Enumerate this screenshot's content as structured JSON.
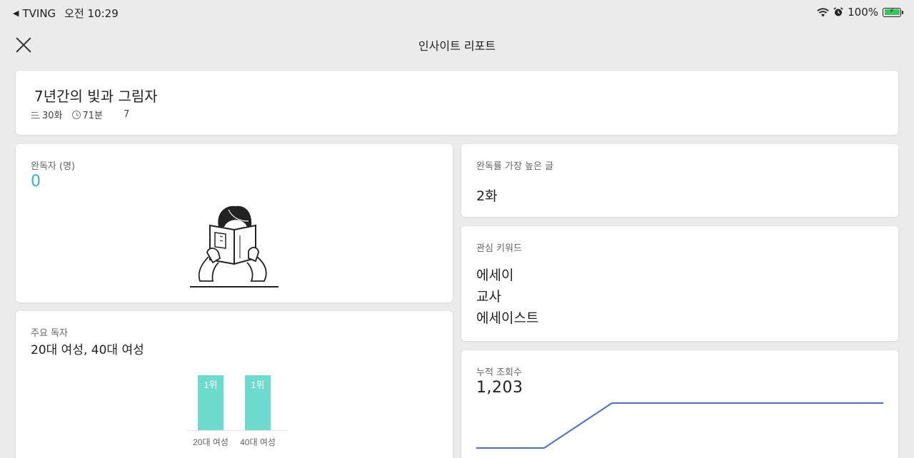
{
  "status_bar": {
    "carrier": "TVING",
    "time": "오전 10:29",
    "battery": "100%"
  },
  "header": {
    "title": "인사이트 리포트"
  },
  "book": {
    "title": "7년간의 빛과 그림자",
    "episodes": "30화",
    "duration": "71분",
    "extra": "7"
  },
  "completion": {
    "label": "완독자 (명)",
    "value": "0"
  },
  "main_readers": {
    "label": "주요 독자",
    "value": "20대 여성, 40대 여성"
  },
  "best_episode": {
    "label": "완독률 가장 높은 글",
    "value": "2화"
  },
  "keywords": {
    "label": "관심 키워드",
    "items": [
      "에세이",
      "교사",
      "에세이스트"
    ]
  },
  "views": {
    "label": "누적 조회수",
    "value": "1,203"
  },
  "colors": {
    "accent_teal": "#34b6b6",
    "bar_teal": "#6ddccf",
    "line_blue": "#4b6fd6"
  },
  "chart_data": [
    {
      "type": "bar",
      "categories": [
        "20대 여성",
        "40대 여성"
      ],
      "bar_labels": [
        "1위",
        "1위"
      ],
      "values": [
        1,
        1
      ]
    },
    {
      "type": "line",
      "x": [
        0,
        1,
        2,
        3,
        4,
        5,
        6
      ],
      "values": [
        0,
        0,
        1,
        1,
        1,
        1,
        1
      ]
    }
  ]
}
